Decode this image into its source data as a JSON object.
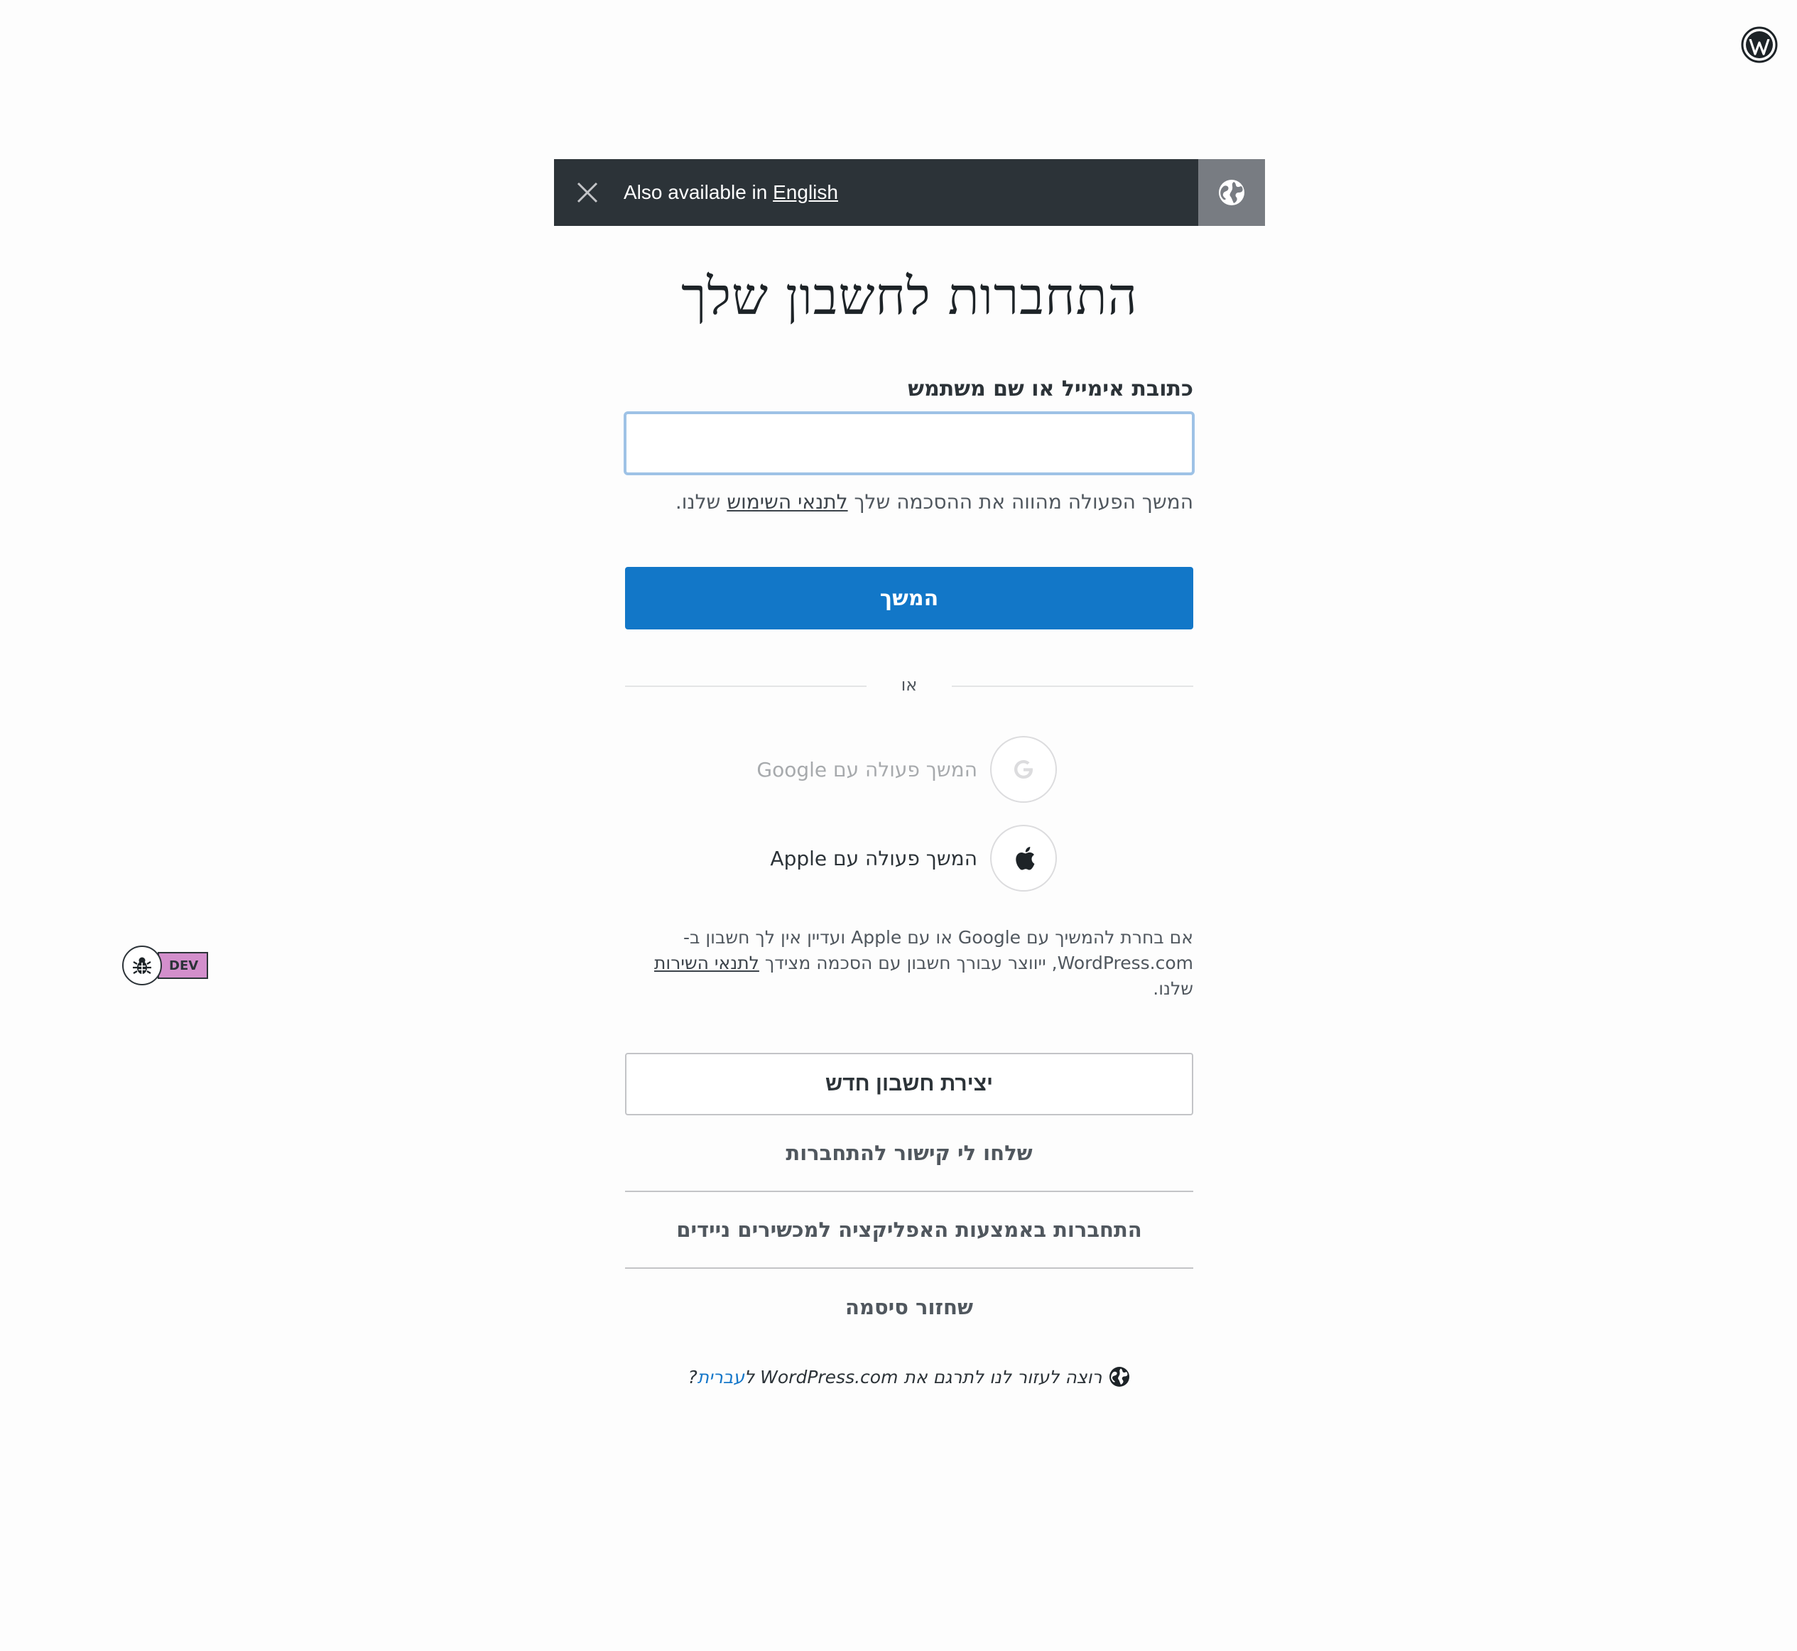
{
  "notice": {
    "prefix": "Also available in",
    "language_link": "English"
  },
  "header": {
    "title": "התחברות לחשבון שלך"
  },
  "login_form": {
    "email_label": "כתובת אימייל או שם משתמש",
    "email_value": "",
    "tos_before": "המשך הפעולה מהווה את ההסכמה שלך ",
    "tos_link": "לתנאי השימוש",
    "tos_after": " שלנו.",
    "continue_label": "המשך",
    "or_label": "או"
  },
  "social": {
    "google_label": "המשך פעולה עם Google",
    "apple_label": "המשך פעולה עם Apple",
    "disclaimer_line1": "אם בחרת להמשיך עם Google או עם Apple ועדיין אין לך חשבון ב-",
    "disclaimer_line2_before": "WordPress.com, ייווצר עבורך חשבון עם הסכמה מצידך ",
    "disclaimer_link": "לתנאי השירות",
    "disclaimer_line2_after": " שלנו."
  },
  "actions": {
    "create_account": "יצירת חשבון חדש",
    "magic_link": "שלחו לי קישור להתחברות",
    "mobile_app": "התחברות באמצעות האפליקציה למכשירים ניידים",
    "lost_password": "שחזור סיסמה"
  },
  "translate": {
    "text": "רוצה לעזור לנו לתרגם את WordPress.com ל",
    "link": "עברית",
    "suffix": "?"
  },
  "dev_badge": {
    "label": "DEV"
  },
  "colors": {
    "primary": "#1277c8",
    "notice_bg": "#2c3338",
    "dev_badge": "#d38fcc"
  },
  "icons": [
    "wordpress-logo-icon",
    "close-icon",
    "globe-icon",
    "google-icon",
    "apple-icon",
    "bug-icon"
  ]
}
